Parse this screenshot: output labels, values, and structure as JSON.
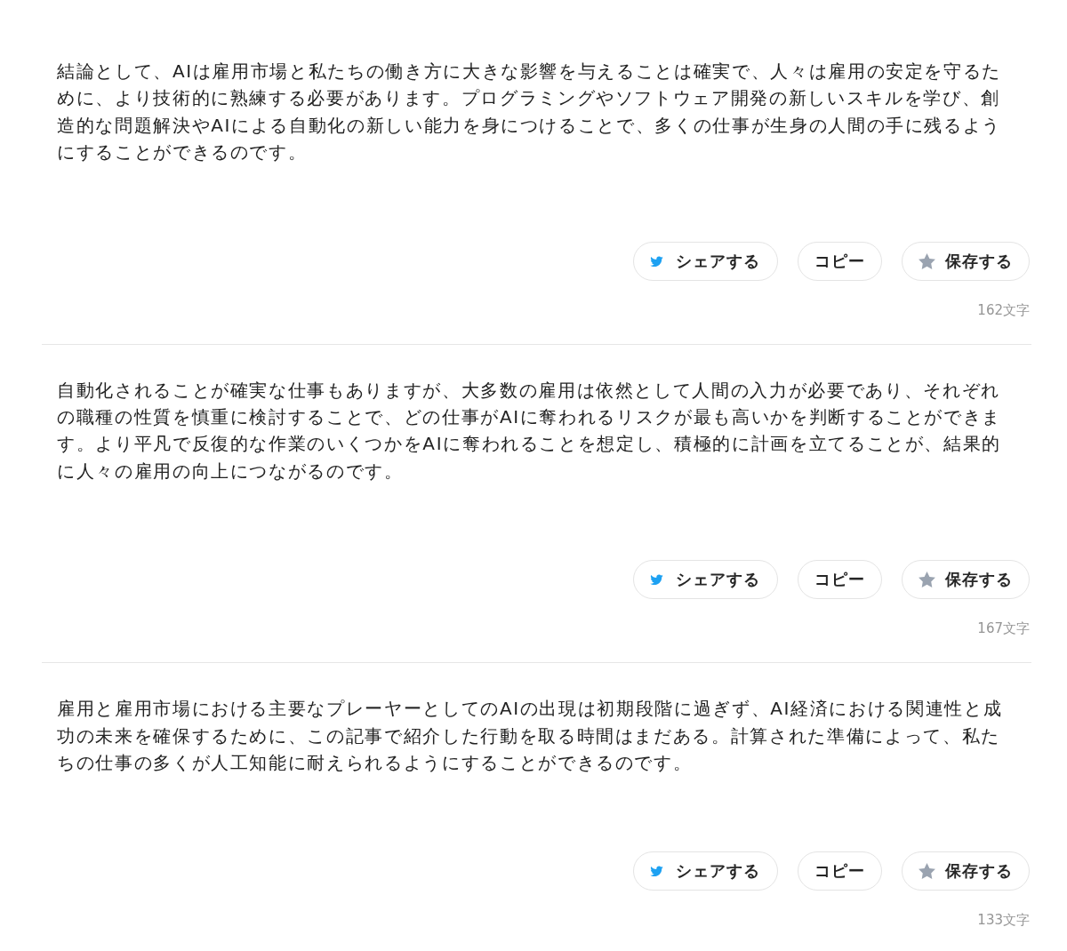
{
  "posts": [
    {
      "text": "結論として、AIは雇用市場と私たちの働き方に大きな影響を与えることは確実で、人々は雇用の安定を守るために、より技術的に熟練する必要があります。プログラミングやソフトウェア開発の新しいスキルを学び、創造的な問題解決やAIによる自動化の新しい能力を身につけることで、多くの仕事が生身の人間の手に残るようにすることができるのです。",
      "buttons": [
        {
          "kind": "share",
          "label": "シェアする"
        },
        {
          "kind": "copy",
          "label": "コピー"
        },
        {
          "kind": "save",
          "label": "保存する"
        }
      ],
      "count": "162文字"
    },
    {
      "text": "自動化されることが確実な仕事もありますが、大多数の雇用は依然として人間の入力が必要であり、それぞれの職種の性質を慎重に検討することで、どの仕事がAIに奪われるリスクが最も高いかを判断することができます。より平凡で反復的な作業のいくつかをAIに奪われることを想定し、積極的に計画を立てることが、結果的に人々の雇用の向上につながるのです。",
      "buttons": [
        {
          "kind": "share",
          "label": "シェアする"
        },
        {
          "kind": "copy",
          "label": "コピー"
        },
        {
          "kind": "save",
          "label": "保存する"
        }
      ],
      "count": "167文字"
    },
    {
      "text": "雇用と雇用市場における主要なプレーヤーとしてのAIの出現は初期段階に過ぎず、AI経済における関連性と成功の未来を確保するために、この記事で紹介した行動を取る時間はまだある。計算された準備によって、私たちの仕事の多くが人工知能に耐えられるようにすることができるのです。",
      "buttons": [
        {
          "kind": "share",
          "label": "シェアする"
        },
        {
          "kind": "copy",
          "label": "コピー"
        },
        {
          "kind": "save",
          "label": "保存する"
        }
      ],
      "count": "133文字"
    }
  ]
}
